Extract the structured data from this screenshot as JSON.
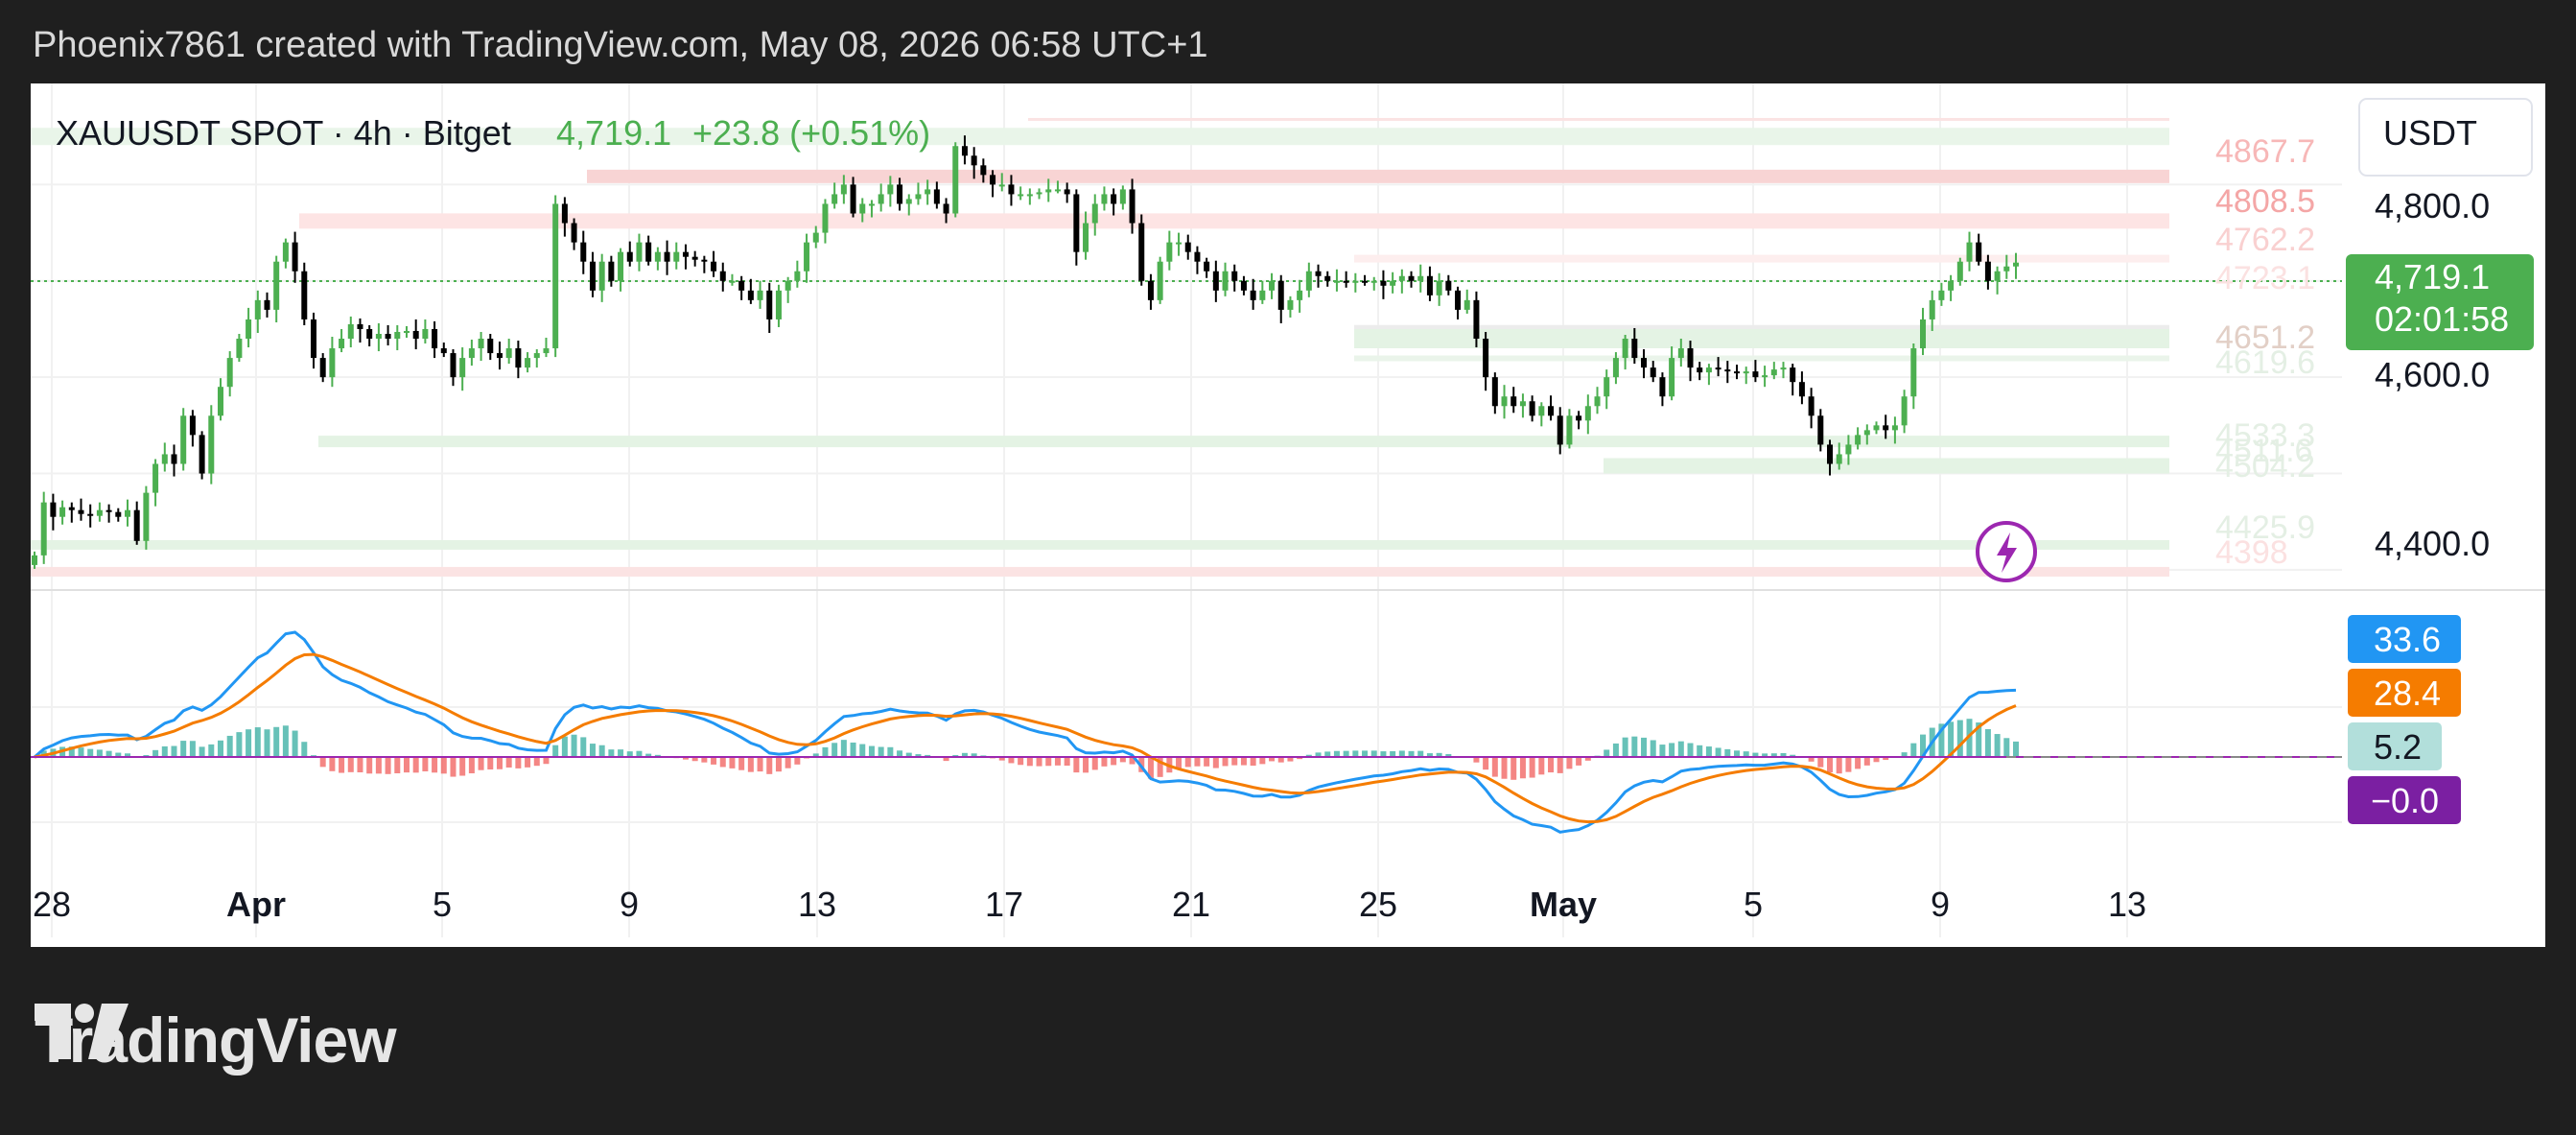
{
  "header": {
    "attribution": "Phoenix7861 created with TradingView.com, May 08, 2026 06:58 UTC+1"
  },
  "brand": {
    "name": "TradingView",
    "icon": "tradingview-logo-icon"
  },
  "colors": {
    "up": "#4caf50",
    "down": "#000000",
    "macd": "#2196f3",
    "signal": "#f57c00",
    "hist_up": "#26a69a",
    "hist_down": "#ef5350",
    "zero": "#9c27b0"
  },
  "chart_data": [
    {
      "type": "candlestick",
      "symbol_line": {
        "symbol": "XAUUSDT SPOT · 4h · Bitget",
        "last": "4,719.1",
        "change": "+23.8 (+0.51%)"
      },
      "currency": "USDT",
      "ylim": [
        4380,
        4905
      ],
      "y_ticks": [
        "4,800.0",
        "4,600.0",
        "4,400.0"
      ],
      "x_ticks": [
        "28",
        "Apr",
        "5",
        "9",
        "13",
        "17",
        "21",
        "25",
        "May",
        "5",
        "9",
        "13"
      ],
      "last_price_label": {
        "price": "4,719.1",
        "countdown": "02:01:58"
      },
      "zone_labels": [
        "4867.7",
        "4808.5",
        "4762.2",
        "4723.1",
        "4651.2",
        "4619.6",
        "4533.3",
        "4511.6",
        "4504.2",
        "4425.9",
        "4398"
      ],
      "close": [
        4415,
        4470,
        4455,
        4465,
        4462,
        4458,
        4456,
        4462,
        4460,
        4455,
        4462,
        4430,
        4480,
        4510,
        4520,
        4510,
        4560,
        4540,
        4500,
        4560,
        4590,
        4620,
        4640,
        4660,
        4680,
        4670,
        4720,
        4740,
        4710,
        4660,
        4620,
        4600,
        4630,
        4640,
        4655,
        4650,
        4640,
        4645,
        4640,
        4647,
        4648,
        4640,
        4650,
        4630,
        4625,
        4600,
        4620,
        4630,
        4640,
        4625,
        4620,
        4630,
        4610,
        4620,
        4625,
        4630,
        4780,
        4760,
        4740,
        4720,
        4690,
        4720,
        4700,
        4730,
        4720,
        4740,
        4720,
        4730,
        4720,
        4730,
        4725,
        4722,
        4720,
        4710,
        4700,
        4700,
        4690,
        4680,
        4690,
        4660,
        4690,
        4700,
        4710,
        4740,
        4750,
        4780,
        4790,
        4800,
        4770,
        4780,
        4780,
        4790,
        4800,
        4780,
        4785,
        4790,
        4795,
        4780,
        4770,
        4840,
        4830,
        4820,
        4810,
        4800,
        4800,
        4790,
        4790,
        4790,
        4792,
        4795,
        4795,
        4790,
        4730,
        4760,
        4780,
        4790,
        4780,
        4795,
        4760,
        4700,
        4680,
        4720,
        4740,
        4740,
        4730,
        4720,
        4710,
        4690,
        4710,
        4700,
        4690,
        4680,
        4690,
        4700,
        4670,
        4680,
        4690,
        4710,
        4705,
        4700,
        4700,
        4698,
        4700,
        4699,
        4700,
        4695,
        4700,
        4705,
        4700,
        4705,
        4685,
        4700,
        4690,
        4670,
        4680,
        4640,
        4600,
        4570,
        4580,
        4570,
        4575,
        4560,
        4570,
        4560,
        4530,
        4560,
        4555,
        4570,
        4580,
        4600,
        4620,
        4640,
        4620,
        4610,
        4600,
        4580,
        4620,
        4630,
        4610,
        4605,
        4610,
        4608,
        4606,
        4604,
        4606,
        4600,
        4602,
        4608,
        4610,
        4595,
        4580,
        4560,
        4530,
        4510,
        4520,
        4530,
        4540,
        4545,
        4550,
        4545,
        4550,
        4580,
        4630,
        4660,
        4680,
        4690,
        4700,
        4720,
        4740,
        4720,
        4700,
        4710,
        4715,
        4719
      ]
    },
    {
      "type": "line",
      "name": "MACD",
      "series": [
        {
          "name": "MACD",
          "color": "#2196f3"
        },
        {
          "name": "Signal",
          "color": "#f57c00"
        }
      ],
      "histogram": {
        "colors": [
          "#26a69a",
          "#ef5350"
        ]
      },
      "value_labels": [
        "33.6",
        "28.4",
        "5.2",
        "−0.0"
      ]
    }
  ]
}
